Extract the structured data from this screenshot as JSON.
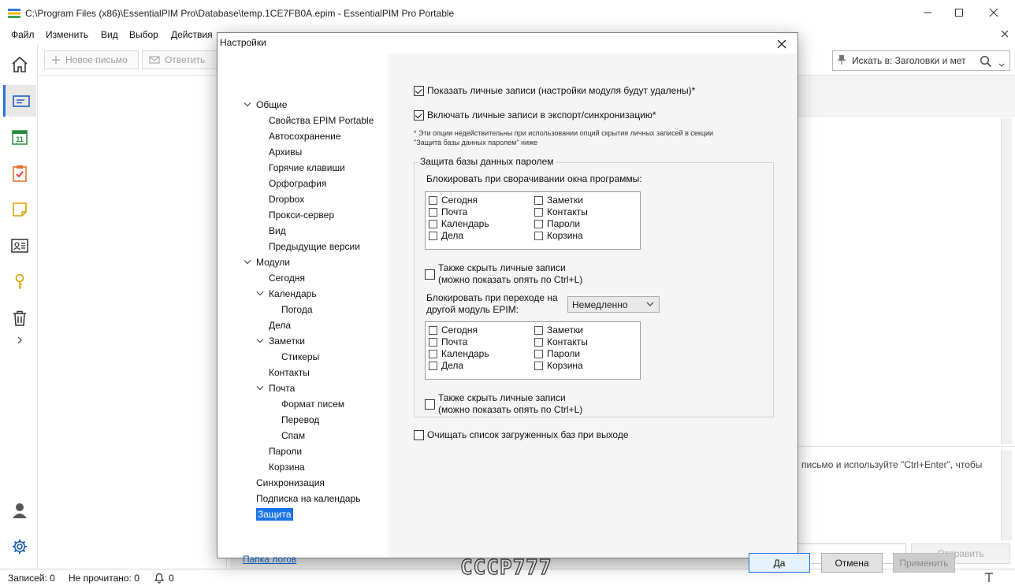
{
  "window": {
    "title": "C:\\Program Files (x86)\\EssentialPIM Pro\\Database\\temp.1CE7FB0A.epim - EssentialPIM Pro Portable"
  },
  "menu": [
    "Файл",
    "Изменить",
    "Вид",
    "Выбор",
    "Действия"
  ],
  "toolbar": {
    "new_mail": "Новое письмо",
    "reply": "Ответить"
  },
  "search": {
    "value": "Искать в: Заголовки и мет"
  },
  "right_panel": {
    "reply_hint": "письмо и используйте \"Ctrl+Enter\", чтобы",
    "send_label": "Отправить"
  },
  "status": {
    "records": "Записей: 0",
    "unread": "Не прочитано: 0",
    "reminders": "0"
  },
  "watermark": "CCCP777",
  "dialog": {
    "title": "Настройки",
    "tree": [
      {
        "label": "Общие",
        "level": 0,
        "expanded": true
      },
      {
        "label": "Свойства EPIM Portable",
        "level": 1
      },
      {
        "label": "Автосохранение",
        "level": 1
      },
      {
        "label": "Архивы",
        "level": 1
      },
      {
        "label": "Горячие клавиши",
        "level": 1
      },
      {
        "label": "Орфография",
        "level": 1
      },
      {
        "label": "Dropbox",
        "level": 1
      },
      {
        "label": "Прокси-сервер",
        "level": 1
      },
      {
        "label": "Вид",
        "level": 1
      },
      {
        "label": "Предыдущие версии",
        "level": 1
      },
      {
        "label": "Модули",
        "level": 0,
        "expanded": true
      },
      {
        "label": "Сегодня",
        "level": 1
      },
      {
        "label": "Календарь",
        "level": 1,
        "expanded": true
      },
      {
        "label": "Погода",
        "level": 2
      },
      {
        "label": "Дела",
        "level": 1
      },
      {
        "label": "Заметки",
        "level": 1,
        "expanded": true
      },
      {
        "label": "Стикеры",
        "level": 2
      },
      {
        "label": "Контакты",
        "level": 1
      },
      {
        "label": "Почта",
        "level": 1,
        "expanded": true
      },
      {
        "label": "Формат писем",
        "level": 2
      },
      {
        "label": "Перевод",
        "level": 2
      },
      {
        "label": "Спам",
        "level": 2
      },
      {
        "label": "Пароли",
        "level": 1
      },
      {
        "label": "Корзина",
        "level": 1
      },
      {
        "label": "Синхронизация",
        "level": 0
      },
      {
        "label": "Подписка на календарь",
        "level": 0
      },
      {
        "label": "Защита",
        "level": 0,
        "selected": true
      }
    ],
    "log_link": "Папка логов",
    "options": {
      "show_private": {
        "label": "Показать личные записи (настройки модуля будут удалены)*",
        "checked": true
      },
      "include_private": {
        "label": "Включать личные записи в экспорт/синхронизацию*",
        "checked": true
      }
    },
    "note_line1": "* Эти опции недействительны при использовании опций скрытия личных записей в секции",
    "note_line2": "\"Защита базы данных паролем\" ниже",
    "protection": {
      "legend": "Защита базы данных паролем",
      "minimize_label": "Блокировать при сворачивании окна программы:",
      "modules_left": [
        "Сегодня",
        "Почта",
        "Календарь",
        "Дела"
      ],
      "modules_right": [
        "Заметки",
        "Контакты",
        "Пароли",
        "Корзина"
      ],
      "hide_private_line1": "Также скрыть личные записи",
      "hide_private_line2": "(можно показать опять по Ctrl+L)",
      "switch_label_line1": "Блокировать при переходе на",
      "switch_label_line2": "другой модуль EPIM:",
      "switch_delay": "Немедленно"
    },
    "clear_list": {
      "label": "Очищать список загруженных баз при выходе",
      "checked": false
    },
    "buttons": {
      "ok": "Да",
      "cancel": "Отмена",
      "apply": "Применить"
    }
  }
}
